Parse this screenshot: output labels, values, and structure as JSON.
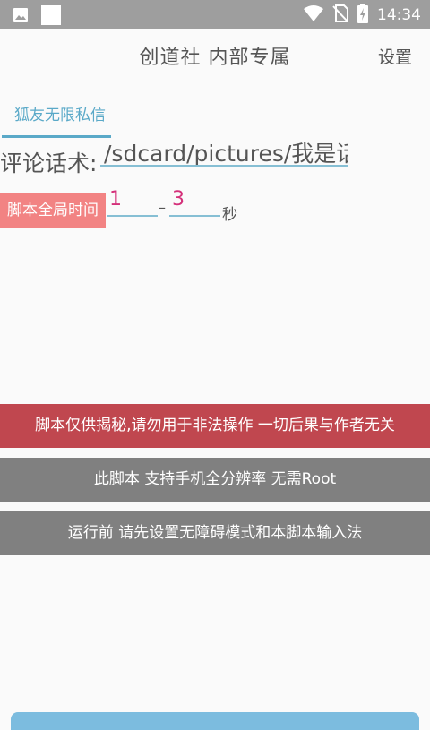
{
  "status_bar": {
    "time": "14:34",
    "icons": [
      "image-icon",
      "square-icon",
      "wifi-icon",
      "no-sim-icon",
      "battery-charging-icon"
    ]
  },
  "header": {
    "title": "创道社 内部专属",
    "settings_label": "设置"
  },
  "tabs": [
    {
      "label": "狐友无限私信",
      "active": true
    }
  ],
  "comment": {
    "label": "评论话术:",
    "value": "/sdcard/pictures/我是话"
  },
  "timing": {
    "label": "脚本全局时间",
    "min": "1",
    "separator": "–",
    "max": "3",
    "unit": "秒"
  },
  "banners": {
    "warning": "脚本仅供揭秘,请勿用于非法操作 一切后果与作者无关",
    "resolution": "此脚本 支持手机全分辨率 无需Root",
    "setup": "运行前 请先设置无障碍模式和本脚本输入法"
  },
  "colors": {
    "status_bar": "#9e9e9e",
    "accent": "#5aa9c8",
    "time_label_bg": "#f28383",
    "number_text": "#d4307a",
    "warning_bg": "#c0474f",
    "info_bg": "#808080",
    "bottom_button": "#7cbcdf"
  }
}
